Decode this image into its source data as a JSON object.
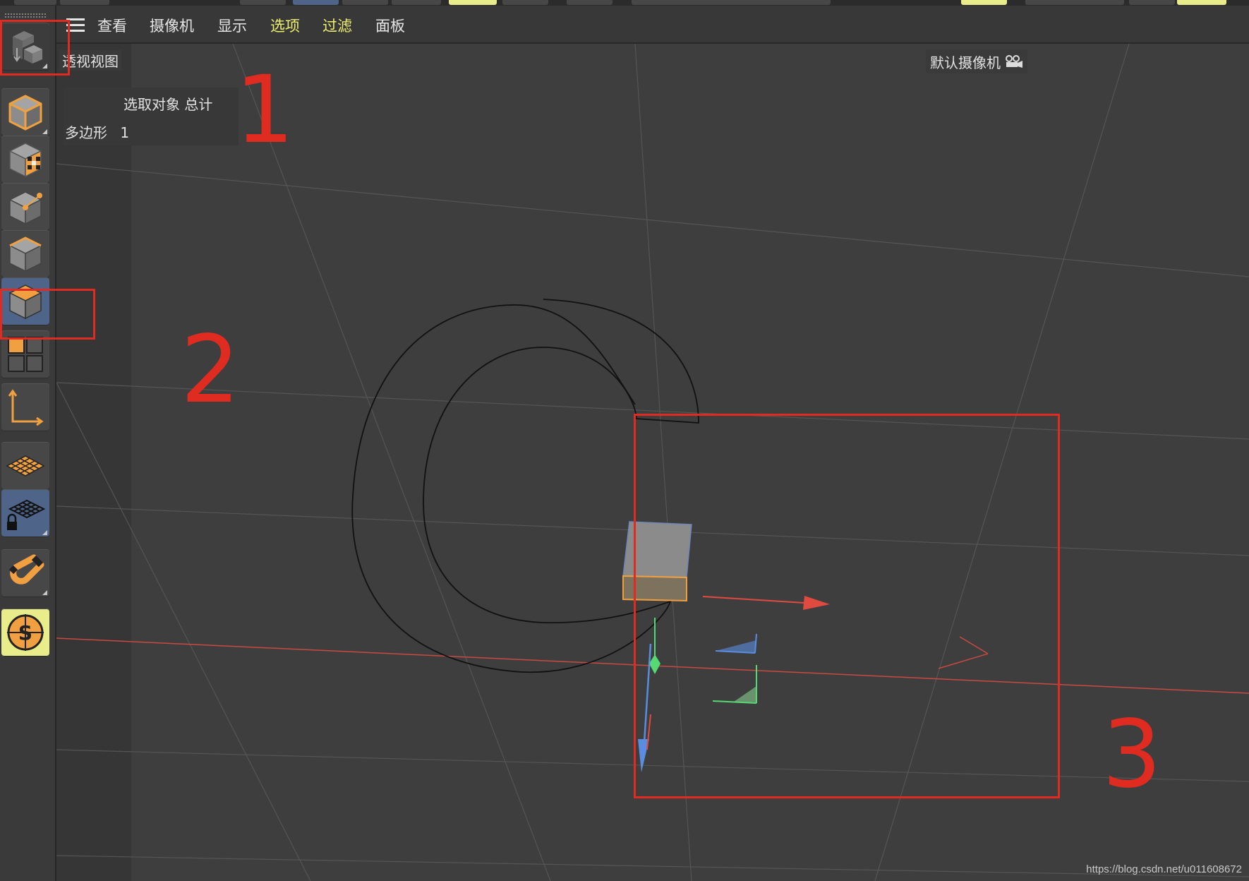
{
  "menu": {
    "items": [
      {
        "label": "查看",
        "highlight": false
      },
      {
        "label": "摄像机",
        "highlight": false
      },
      {
        "label": "显示",
        "highlight": false
      },
      {
        "label": "选项",
        "highlight": true
      },
      {
        "label": "过滤",
        "highlight": true
      },
      {
        "label": "面板",
        "highlight": false
      }
    ]
  },
  "viewport": {
    "view_name": "透视视图",
    "camera_name": "默认摄像机",
    "hud": {
      "header": "选取对象  总计",
      "row_label": "多边形",
      "row_value": "1"
    }
  },
  "toolbar": {
    "tools": [
      {
        "name": "convert-object-tool-icon",
        "active": false
      },
      {
        "name": "model-mode-icon",
        "active": false
      },
      {
        "name": "texture-mode-icon",
        "active": false
      },
      {
        "name": "point-mode-icon",
        "active": false
      },
      {
        "name": "edge-mode-icon",
        "active": false
      },
      {
        "name": "polygon-mode-icon",
        "active": true
      },
      {
        "name": "uv-mode-icon",
        "active": false
      },
      {
        "name": "axis-mode-icon",
        "active": false
      },
      {
        "name": "workplane-icon",
        "active": false
      },
      {
        "name": "locked-workplane-icon",
        "active": true
      },
      {
        "name": "snap-magnet-icon",
        "active": false
      },
      {
        "name": "script-s-icon",
        "active": false
      }
    ]
  },
  "annotations": [
    "1",
    "2",
    "3"
  ],
  "watermark": "https://blog.csdn.net/u011608672",
  "colors": {
    "accent_orange": "#f0a040",
    "active_blue": "#4e6488",
    "menu_highlight": "#f0f070",
    "annotation_red": "#e02b20"
  }
}
